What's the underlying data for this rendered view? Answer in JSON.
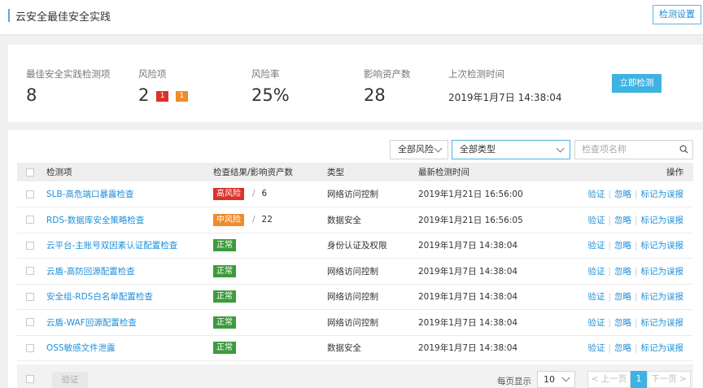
{
  "header": {
    "title": "云安全最佳安全实践",
    "settings_button": "检测设置"
  },
  "stats": {
    "check_items": {
      "label": "最佳安全实践检测项",
      "value": "8"
    },
    "risk_items": {
      "label": "风险项",
      "value": "2",
      "badge_high": "1",
      "badge_mid": "1"
    },
    "risk_rate": {
      "label": "风险率",
      "value": "25%"
    },
    "assets": {
      "label": "影响资产数",
      "value": "28"
    },
    "last_check": {
      "label": "上次检测时间",
      "value": "2019年1月7日 14:38:04"
    },
    "detect_button": "立即检测"
  },
  "filters": {
    "risk": "全部风险",
    "type": "全部类型",
    "search_placeholder": "检查项名称"
  },
  "table": {
    "headers": {
      "item": "检测项",
      "result": "检查结果/影响资产数",
      "type": "类型",
      "time": "最新检测时间",
      "actions": "操作"
    },
    "rows": [
      {
        "name": "SLB-高危端口暴露检查",
        "status": "高风险",
        "level": "high",
        "assets": "6",
        "type": "网络访问控制",
        "time": "2019年1月21日 16:56:00"
      },
      {
        "name": "RDS-数据库安全策略检查",
        "status": "中风险",
        "level": "mid",
        "assets": "22",
        "type": "数据安全",
        "time": "2019年1月21日 16:56:05"
      },
      {
        "name": "云平台-主账号双因素认证配置检查",
        "status": "正常",
        "level": "ok",
        "assets": "",
        "type": "身份认证及权限",
        "time": "2019年1月7日 14:38:04"
      },
      {
        "name": "云盾-高防回源配置检查",
        "status": "正常",
        "level": "ok",
        "assets": "",
        "type": "网络访问控制",
        "time": "2019年1月7日 14:38:04"
      },
      {
        "name": "安全组-RDS白名单配置检查",
        "status": "正常",
        "level": "ok",
        "assets": "",
        "type": "网络访问控制",
        "time": "2019年1月7日 14:38:04"
      },
      {
        "name": "云盾-WAF回源配置检查",
        "status": "正常",
        "level": "ok",
        "assets": "",
        "type": "网络访问控制",
        "time": "2019年1月7日 14:38:04"
      },
      {
        "name": "OSS敏感文件泄露",
        "status": "正常",
        "level": "ok",
        "assets": "",
        "type": "数据安全",
        "time": "2019年1月7日 14:38:04"
      }
    ],
    "actions": {
      "verify": "验证",
      "ignore": "忽略",
      "mark": "标记为误报"
    }
  },
  "footer": {
    "verify_button": "验证",
    "per_page_label": "每页显示",
    "per_page": "10",
    "prev": "< 上一页",
    "page": "1",
    "next": "下一页 >"
  },
  "colors": {
    "accent": "#3db2e3",
    "high": "#d9332b",
    "mid": "#ee8b2d",
    "ok": "#3e9b3d",
    "link": "#1f8fd8"
  }
}
